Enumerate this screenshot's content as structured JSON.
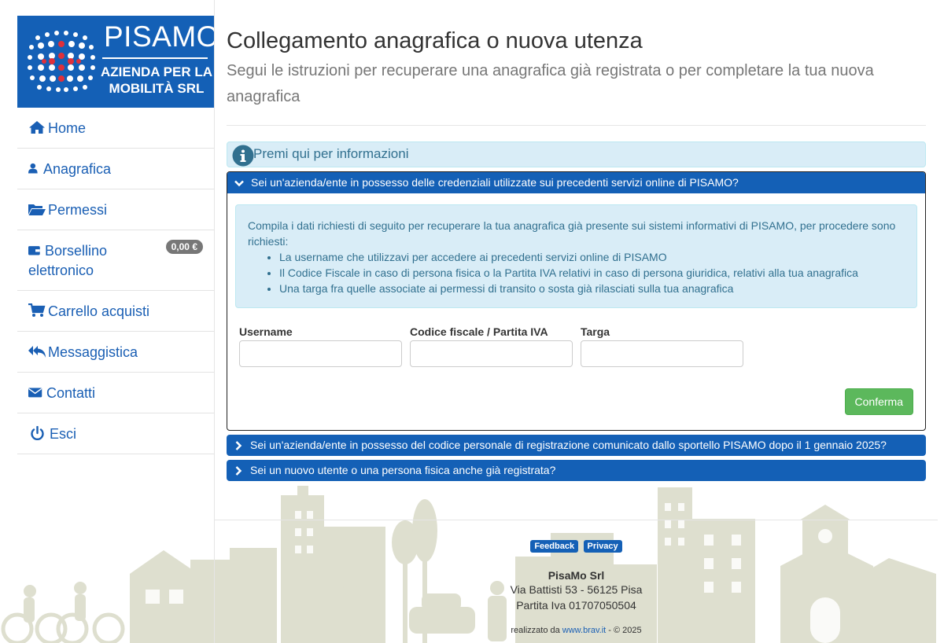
{
  "logo": {
    "brand": "PISAMO",
    "subtitle_line1": "AZIENDA PER LA",
    "subtitle_line2": "MOBILITÀ SRL"
  },
  "sidebar": {
    "items": [
      {
        "label": "Home",
        "icon": "home-icon"
      },
      {
        "label": "Anagrafica",
        "icon": "user-icon"
      },
      {
        "label": "Permessi",
        "icon": "folder-open-icon"
      },
      {
        "label": "Borsellino elettronico",
        "icon": "wallet-icon",
        "badge": "0,00 €"
      },
      {
        "label": "Carrello acquisti",
        "icon": "cart-icon"
      },
      {
        "label": "Messaggistica",
        "icon": "reply-all-icon"
      },
      {
        "label": "Contatti",
        "icon": "envelope-icon"
      },
      {
        "label": "Esci",
        "icon": "power-icon"
      }
    ]
  },
  "main": {
    "title": "Collegamento anagrafica o nuova utenza",
    "subtitle": "Segui le istruzioni per recuperare una anagrafica già registrata o per completare la tua nuova anagrafica",
    "info_label": "Premi qui per informazioni",
    "accordion": [
      {
        "title": "Sei un'azienda/ente in possesso delle credenziali utilizzate sui precedenti servizi online di PISAMO?",
        "expanded": true,
        "intro": "Compila i dati richiesti di seguito per recuperare la tua anagrafica già presente sui sistemi informativi di PISAMO, per procedere sono richiesti:",
        "requirements": [
          "La username che utilizzavi per accedere ai precedenti servizi online di PISAMO",
          "Il Codice Fiscale in caso di persona fisica o la Partita IVA relativi in caso di persona giuridica, relativi alla tua anagrafica",
          "Una targa fra quelle associate ai permessi di transito o sosta già rilasciati sulla tua anagrafica"
        ],
        "fields": [
          {
            "label": "Username",
            "value": ""
          },
          {
            "label": "Codice fiscale / Partita IVA",
            "value": ""
          },
          {
            "label": "Targa",
            "value": ""
          }
        ],
        "confirm_label": "Conferma"
      },
      {
        "title": "Sei un'azienda/ente in possesso del codice personale di registrazione comunicato dallo sportello PISAMO dopo il 1 gennaio 2025?",
        "expanded": false
      },
      {
        "title": "Sei un nuovo utente o una persona fisica anche già registrata?",
        "expanded": false
      }
    ]
  },
  "footer": {
    "feedback_label": "Feedback",
    "privacy_label": "Privacy",
    "company": "PisaMo Srl",
    "address": "Via Battisti 53 - 56125 Pisa",
    "vat": "Partita Iva 01707050504",
    "credit_prefix": "realizzato da ",
    "credit_link": "www.brav.it",
    "credit_suffix": " - © 2025"
  },
  "colors": {
    "brand_blue": "#1460b6",
    "info_bg": "#d9edf7",
    "success_green": "#5cb85c",
    "skyline": "#dcdccc"
  }
}
